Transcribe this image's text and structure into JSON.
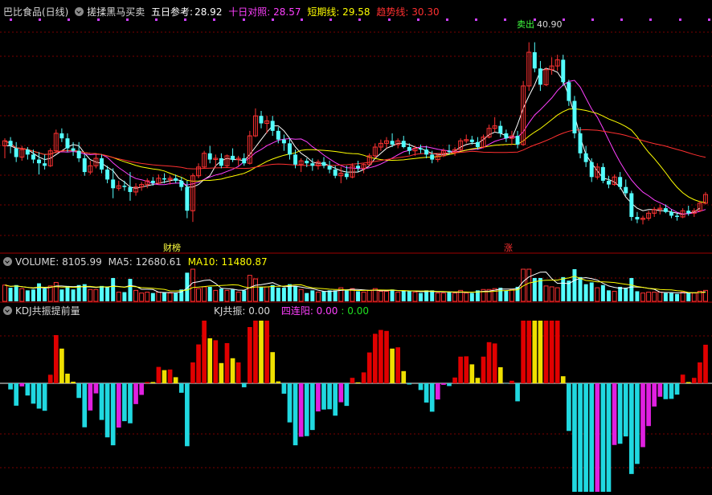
{
  "title": {
    "name": "巴比食品(日线)",
    "indicator": "搓揉黑马买卖",
    "p1_label": "五日参考:",
    "p1_value": "28.92",
    "p2": "十日对照: 28.57",
    "p3": "短期线: 29.58",
    "p4": "趋势线: 30.30"
  },
  "colors": {
    "up": "#ff3232",
    "down": "#54ffff",
    "ma5": "#ffffff",
    "ma10": "#ff40ff",
    "ma20": "#ffff00",
    "ma60": "#ff3030",
    "kdj_red": "#e00000",
    "kdj_yellow": "#f0e000",
    "kdj_cyan": "#20d8e0",
    "kdj_magenta": "#e020e0",
    "grid": "#7a0000"
  },
  "markers": {
    "left": "财榜",
    "right": "涨",
    "peak_label": "卖出",
    "peak_value": "40.90"
  },
  "volume": {
    "label": "VOLUME: 8105.99",
    "ma5": "MA5: 12680.61",
    "ma10": "MA10: 11480.87"
  },
  "kdj": {
    "label": "KDJ共振提前量",
    "kj": "KJ共振: 0.00",
    "lyy": "四连阳: 0.00",
    "lyy2": ": 0.00"
  },
  "chart_data": {
    "type": "candlestick",
    "price_range": [
      24,
      43
    ],
    "candles": [
      [
        32.6,
        33.2,
        31.6,
        33.0
      ],
      [
        33.0,
        33.3,
        32.0,
        32.6
      ],
      [
        32.4,
        32.9,
        31.3,
        31.7
      ],
      [
        31.7,
        32.6,
        31.4,
        32.3
      ],
      [
        32.3,
        32.5,
        31.5,
        31.9
      ],
      [
        31.9,
        32.3,
        31.2,
        31.5
      ],
      [
        31.5,
        32.1,
        30.3,
        31.2
      ],
      [
        31.2,
        31.9,
        30.7,
        31.0
      ],
      [
        31.0,
        32.4,
        30.9,
        32.2
      ],
      [
        32.2,
        33.9,
        32.0,
        33.6
      ],
      [
        33.6,
        34.0,
        32.9,
        33.2
      ],
      [
        33.2,
        33.6,
        32.1,
        32.4
      ],
      [
        32.4,
        32.9,
        31.8,
        32.2
      ],
      [
        32.2,
        32.9,
        31.3,
        31.6
      ],
      [
        31.6,
        31.9,
        30.2,
        30.5
      ],
      [
        30.5,
        31.4,
        30.3,
        31.0
      ],
      [
        31.0,
        31.9,
        30.8,
        31.6
      ],
      [
        31.6,
        31.9,
        30.4,
        30.7
      ],
      [
        30.7,
        31.0,
        29.6,
        29.9
      ],
      [
        29.9,
        30.8,
        28.4,
        29.2
      ],
      [
        29.2,
        29.8,
        29.0,
        29.4
      ],
      [
        29.4,
        29.8,
        29.0,
        29.3
      ],
      [
        29.3,
        30.5,
        28.2,
        28.9
      ],
      [
        28.9,
        29.6,
        28.6,
        29.3
      ],
      [
        29.3,
        29.7,
        29.0,
        29.5
      ],
      [
        29.5,
        30.0,
        29.2,
        29.8
      ],
      [
        29.8,
        30.1,
        29.4,
        29.6
      ],
      [
        29.6,
        30.3,
        29.5,
        30.0
      ],
      [
        30.0,
        30.4,
        29.6,
        29.9
      ],
      [
        29.9,
        30.2,
        29.5,
        30.0
      ],
      [
        30.0,
        30.3,
        29.6,
        29.8
      ],
      [
        29.8,
        30.1,
        29.0,
        29.3
      ],
      [
        29.3,
        29.8,
        26.8,
        27.4
      ],
      [
        27.4,
        30.4,
        26.5,
        30.2
      ],
      [
        30.2,
        31.2,
        30.0,
        30.9
      ],
      [
        30.9,
        32.2,
        30.8,
        32.0
      ],
      [
        32.0,
        32.6,
        31.2,
        31.5
      ],
      [
        31.5,
        31.9,
        30.9,
        31.6
      ],
      [
        31.6,
        32.0,
        30.8,
        31.0
      ],
      [
        31.0,
        31.9,
        30.9,
        31.8
      ],
      [
        31.8,
        32.4,
        31.3,
        31.5
      ],
      [
        31.5,
        31.8,
        31.0,
        31.6
      ],
      [
        31.6,
        32.0,
        31.0,
        31.2
      ],
      [
        31.2,
        33.8,
        31.1,
        33.4
      ],
      [
        33.4,
        35.6,
        33.3,
        35.0
      ],
      [
        35.0,
        35.4,
        34.0,
        34.4
      ],
      [
        34.4,
        35.0,
        33.6,
        34.6
      ],
      [
        34.6,
        35.0,
        33.4,
        33.8
      ],
      [
        33.8,
        34.1,
        32.8,
        33.1
      ],
      [
        33.1,
        33.5,
        32.2,
        32.8
      ],
      [
        32.8,
        33.2,
        31.5,
        31.9
      ],
      [
        31.9,
        32.3,
        30.8,
        31.1
      ],
      [
        31.1,
        31.6,
        30.5,
        31.4
      ],
      [
        31.4,
        31.6,
        30.9,
        31.2
      ],
      [
        31.2,
        31.6,
        30.6,
        31.0
      ],
      [
        31.0,
        31.5,
        30.7,
        31.3
      ],
      [
        31.3,
        31.7,
        30.8,
        31.0
      ],
      [
        31.0,
        31.4,
        30.4,
        30.7
      ],
      [
        30.7,
        31.0,
        30.0,
        30.2
      ],
      [
        30.2,
        30.9,
        29.6,
        30.4
      ],
      [
        30.4,
        31.0,
        29.9,
        30.1
      ],
      [
        30.1,
        31.2,
        30.0,
        31.0
      ],
      [
        31.0,
        31.4,
        30.5,
        30.8
      ],
      [
        30.8,
        31.2,
        30.4,
        31.1
      ],
      [
        31.1,
        32.0,
        31.0,
        31.8
      ],
      [
        31.8,
        32.8,
        31.6,
        32.5
      ],
      [
        32.5,
        33.1,
        32.2,
        32.8
      ],
      [
        32.8,
        33.3,
        32.4,
        33.0
      ],
      [
        33.0,
        33.6,
        32.5,
        32.7
      ],
      [
        32.7,
        33.2,
        32.4,
        33.0
      ],
      [
        33.0,
        33.4,
        32.4,
        32.5
      ],
      [
        32.5,
        32.8,
        31.9,
        32.2
      ],
      [
        32.2,
        32.6,
        31.8,
        32.4
      ],
      [
        32.4,
        32.7,
        32.0,
        32.3
      ],
      [
        32.3,
        32.6,
        31.6,
        31.9
      ],
      [
        31.9,
        32.2,
        31.2,
        31.5
      ],
      [
        31.5,
        32.0,
        31.3,
        31.8
      ],
      [
        31.8,
        32.4,
        31.7,
        32.2
      ],
      [
        32.2,
        32.7,
        31.9,
        32.1
      ],
      [
        32.1,
        32.5,
        31.8,
        32.3
      ],
      [
        32.3,
        33.2,
        32.2,
        33.0
      ],
      [
        33.0,
        33.5,
        32.8,
        33.1
      ],
      [
        33.1,
        33.4,
        32.7,
        32.9
      ],
      [
        32.9,
        33.3,
        32.3,
        32.5
      ],
      [
        32.5,
        33.5,
        32.4,
        33.3
      ],
      [
        33.3,
        34.3,
        33.2,
        34.0
      ],
      [
        34.0,
        34.9,
        33.7,
        34.2
      ],
      [
        34.2,
        34.6,
        33.3,
        33.6
      ],
      [
        33.6,
        33.9,
        32.9,
        33.2
      ],
      [
        33.2,
        33.8,
        32.7,
        33.4
      ],
      [
        33.4,
        33.8,
        32.4,
        32.7
      ],
      [
        32.7,
        37.8,
        32.6,
        37.4
      ],
      [
        37.4,
        40.9,
        37.0,
        40.1
      ],
      [
        40.1,
        40.9,
        38.5,
        38.8
      ],
      [
        38.8,
        39.4,
        37.0,
        37.5
      ],
      [
        37.5,
        38.9,
        37.4,
        38.7
      ],
      [
        38.7,
        39.7,
        38.3,
        39.0
      ],
      [
        39.0,
        39.9,
        38.6,
        39.5
      ],
      [
        39.5,
        39.9,
        37.4,
        37.7
      ],
      [
        37.7,
        37.9,
        35.8,
        36.2
      ],
      [
        36.2,
        36.6,
        33.2,
        33.6
      ],
      [
        33.6,
        34.1,
        31.6,
        32.0
      ],
      [
        32.0,
        32.6,
        30.9,
        31.3
      ],
      [
        31.3,
        31.6,
        29.7,
        30.1
      ],
      [
        30.1,
        31.2,
        29.9,
        30.9
      ],
      [
        30.9,
        31.2,
        29.6,
        29.8
      ],
      [
        29.8,
        30.2,
        29.2,
        29.5
      ],
      [
        29.5,
        30.3,
        29.4,
        30.1
      ],
      [
        30.1,
        30.5,
        29.1,
        29.3
      ],
      [
        29.3,
        29.9,
        28.6,
        28.8
      ],
      [
        28.8,
        29.0,
        26.6,
        26.9
      ],
      [
        26.9,
        27.3,
        26.4,
        26.7
      ],
      [
        26.7,
        27.0,
        26.3,
        26.8
      ],
      [
        26.8,
        27.4,
        26.6,
        27.2
      ],
      [
        27.2,
        27.7,
        26.9,
        27.5
      ],
      [
        27.5,
        27.9,
        27.1,
        27.6
      ],
      [
        27.6,
        27.9,
        27.2,
        27.3
      ],
      [
        27.3,
        27.5,
        26.8,
        27.0
      ],
      [
        27.0,
        27.2,
        26.6,
        26.9
      ],
      [
        26.9,
        27.6,
        26.8,
        27.4
      ],
      [
        27.4,
        27.8,
        27.0,
        27.2
      ],
      [
        27.2,
        27.6,
        26.9,
        27.4
      ],
      [
        27.4,
        28.2,
        27.3,
        28.0
      ],
      [
        28.0,
        28.9,
        27.9,
        28.7
      ]
    ],
    "ma5": [
      32.6,
      32.6,
      32.4,
      32.4,
      32.3,
      32.0,
      31.7,
      31.5,
      31.6,
      31.9,
      32.2,
      32.5,
      32.7,
      32.6,
      32.0,
      31.5,
      31.3,
      31.2,
      30.9,
      30.6,
      30.0,
      29.7,
      29.3,
      29.2,
      29.3,
      29.4,
      29.5,
      29.6,
      29.7,
      29.8,
      29.9,
      29.8,
      29.3,
      29.3,
      29.5,
      29.9,
      30.2,
      31.0,
      31.4,
      31.6,
      31.5,
      31.5,
      31.4,
      31.9,
      32.5,
      33.1,
      33.7,
      34.2,
      34.2,
      33.8,
      33.2,
      32.5,
      32.0,
      31.7,
      31.3,
      31.2,
      31.2,
      31.0,
      30.8,
      30.6,
      30.5,
      30.5,
      30.5,
      30.7,
      31.0,
      31.6,
      32.0,
      32.4,
      32.6,
      32.8,
      32.8,
      32.7,
      32.5,
      32.4,
      32.2,
      32.0,
      31.9,
      31.9,
      32.0,
      32.2,
      32.5,
      32.7,
      32.8,
      32.8,
      33.1,
      33.5,
      33.7,
      33.6,
      33.4,
      33.2,
      34.3,
      35.6,
      36.6,
      37.5,
      38.6,
      38.8,
      38.7,
      38.5,
      37.8,
      36.6,
      35.1,
      33.3,
      31.9,
      31.2,
      30.6,
      30.0,
      29.9,
      29.7,
      29.3,
      28.5,
      28.0,
      27.6,
      27.4,
      27.5,
      27.5,
      27.4,
      27.4,
      27.3,
      27.2,
      27.1,
      27.2,
      27.3,
      27.6
    ]
  }
}
